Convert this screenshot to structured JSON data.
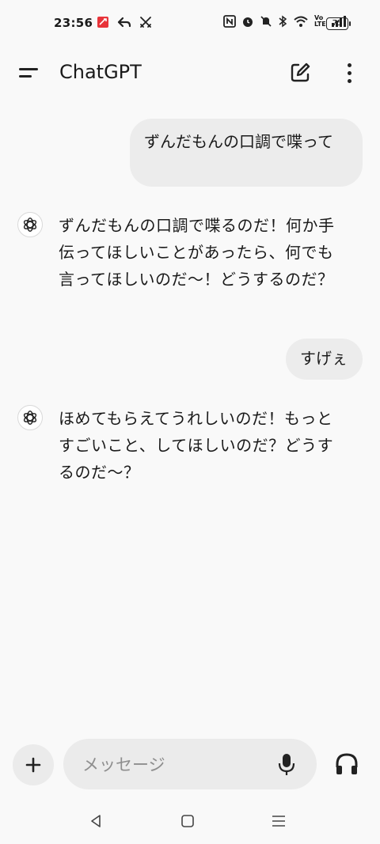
{
  "status_bar": {
    "time": "23:56",
    "battery": "75",
    "left_icons": [
      "red-app-icon",
      "reply-arrow-icon",
      "crossed-swords-icon"
    ],
    "right_icons": [
      "nfc-icon",
      "alarm-icon",
      "mute-icon",
      "bluetooth-icon",
      "wifi-icon",
      "volte-icon",
      "signal-icon"
    ],
    "volte_label": "Vo LTE"
  },
  "header": {
    "title": "ChatGPT",
    "menu_icon": "menu-icon",
    "new_chat_icon": "edit-icon",
    "more_icon": "more-vertical-icon"
  },
  "messages": [
    {
      "role": "user",
      "text": "ずんだもんの口調で喋って"
    },
    {
      "role": "assistant",
      "text": "ずんだもんの口調で喋るのだ！何か手伝ってほしいことがあったら、何でも言ってほしいのだ〜！どうするのだ？"
    },
    {
      "role": "user",
      "text": "すげぇ"
    },
    {
      "role": "assistant",
      "text": "ほめてもらえてうれしいのだ！もっとすごいこと、してほしいのだ？どうするのだ〜？"
    }
  ],
  "composer": {
    "placeholder": "メッセージ",
    "value": "",
    "plus_icon": "plus-icon",
    "mic_icon": "microphone-icon",
    "voice_icon": "headphones-icon"
  },
  "nav_bar": {
    "icons": [
      "back-triangle-icon",
      "home-square-icon",
      "recents-lines-icon"
    ]
  },
  "colors": {
    "background": "#f9f9f9",
    "bubble": "#ececec",
    "text": "#1a1a1a",
    "placeholder": "#8e8e8e",
    "status_red": "#e8343a"
  }
}
